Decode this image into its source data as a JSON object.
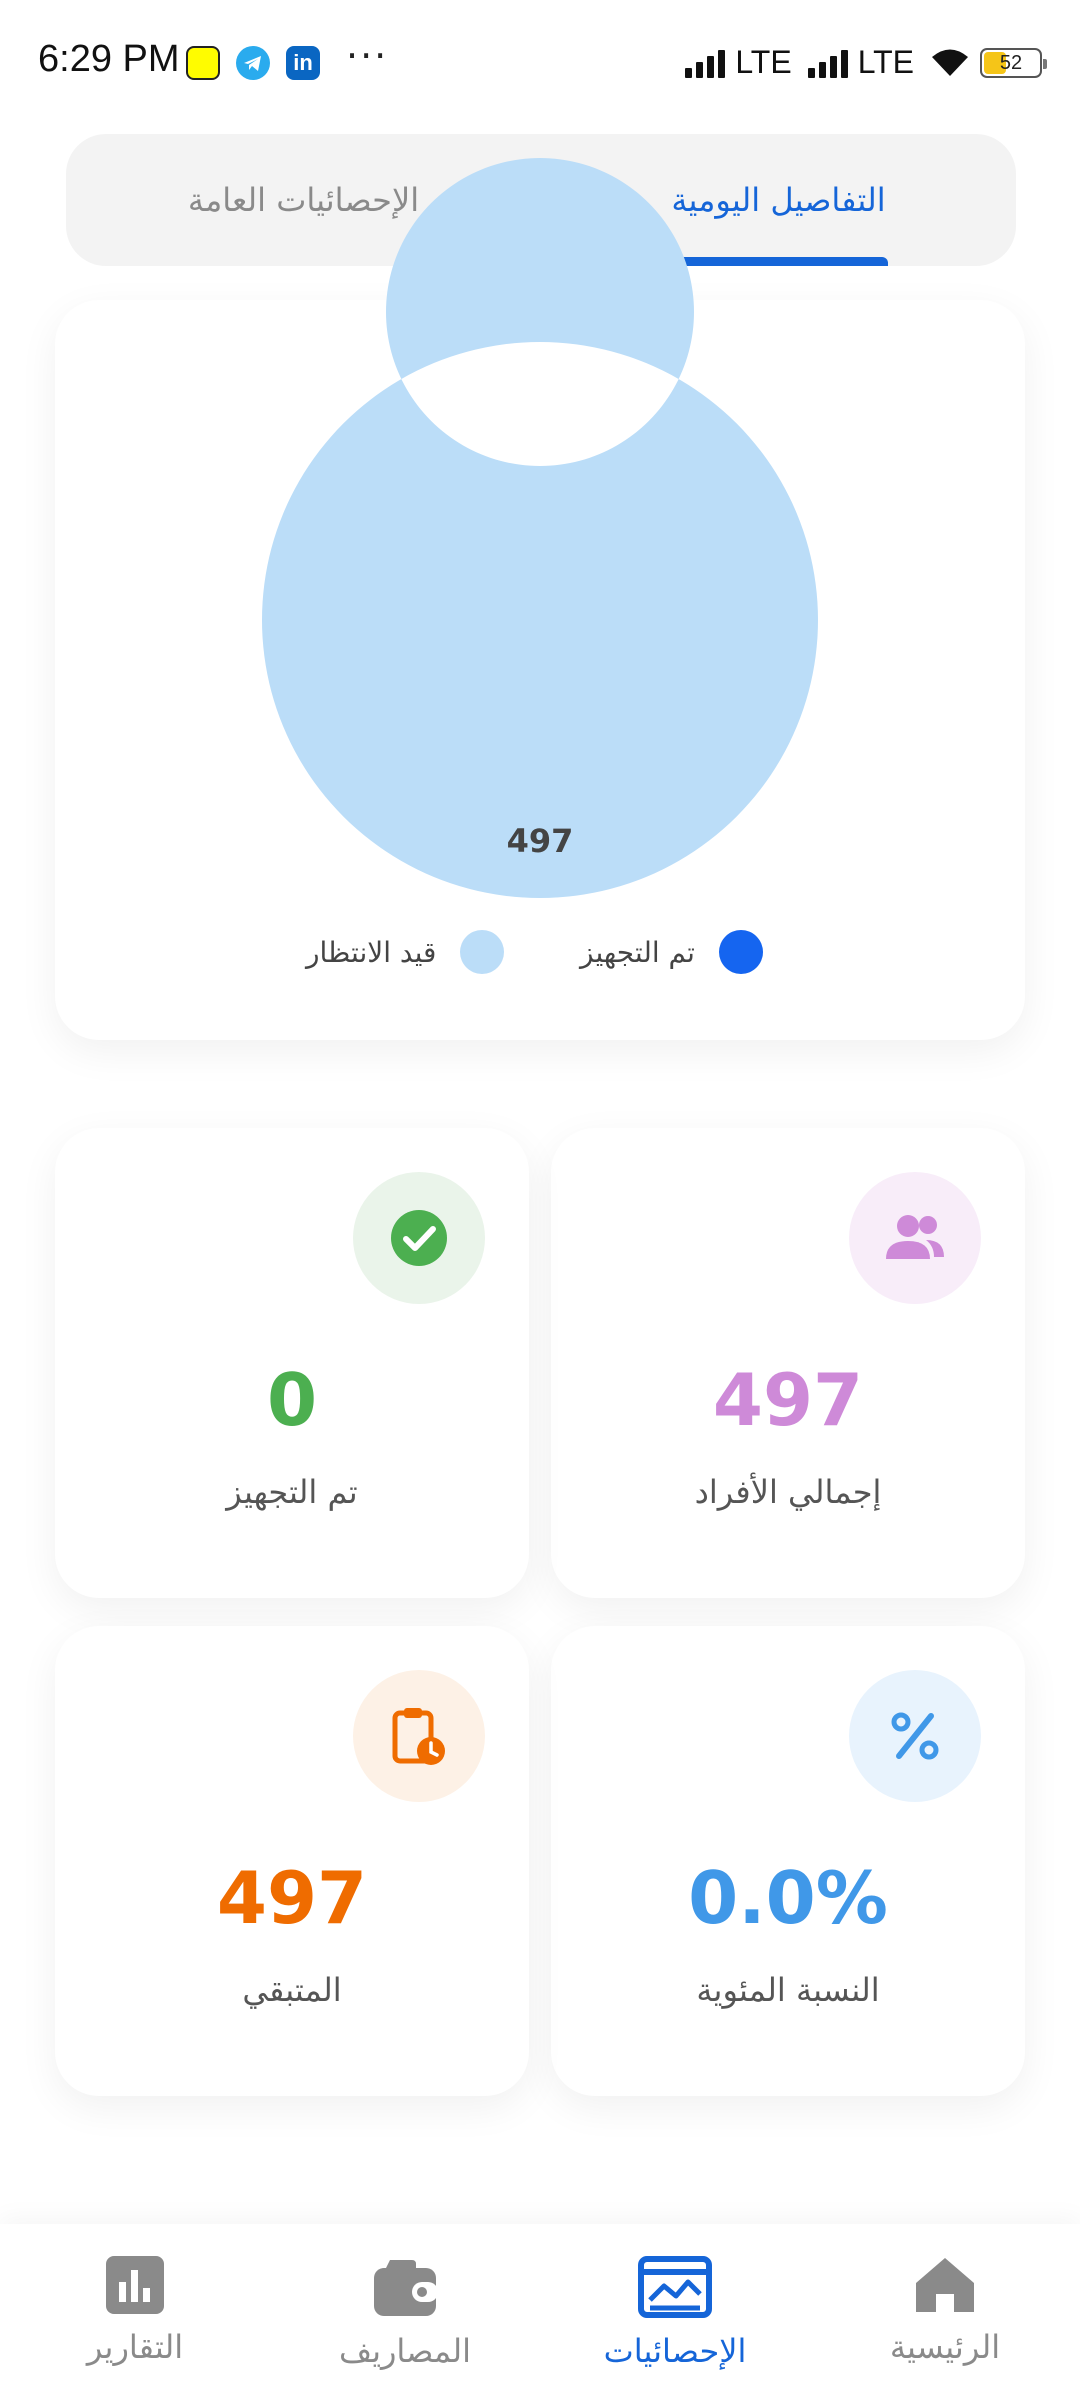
{
  "status_bar": {
    "time": "6:29 PM",
    "app_icons": [
      "snapchat-icon",
      "telegram-icon",
      "linkedin-icon"
    ],
    "linkedin_text": "in",
    "more": "···",
    "network_1": "LTE",
    "network_2": "LTE",
    "battery": "52"
  },
  "tabs": {
    "daily_details": "التفاصيل اليومية",
    "general_stats": "الإحصائيات العامة",
    "active": "daily_details"
  },
  "chart_data": {
    "type": "pie",
    "variant": "donut",
    "categories": [
      "تم التجهيز",
      "قيد الانتظار"
    ],
    "values": [
      0,
      497
    ],
    "colors": [
      "#1565F0",
      "#BBDDF8"
    ],
    "data_labels": [
      "497"
    ],
    "legend_position": "bottom"
  },
  "stats": {
    "total_members": {
      "value": "497",
      "label": "إجمالي الأفراد",
      "color": "#CE8AD8",
      "icon": "people-icon",
      "icon_bg": "#F8EDF9"
    },
    "prepared": {
      "value": "0",
      "label": "تم التجهيز",
      "color": "#4CAF50",
      "icon": "check-circle-icon",
      "icon_bg": "#EAF4EA"
    },
    "percentage": {
      "value": "0.0%",
      "label": "النسبة المئوية",
      "color": "#4098E8",
      "icon": "percent-icon",
      "icon_bg": "#E8F3FD"
    },
    "remaining": {
      "value": "497",
      "label": "المتبقي",
      "color": "#EF6C00",
      "icon": "clipboard-clock-icon",
      "icon_bg": "#FDF1E6"
    }
  },
  "bottom_nav": {
    "items": [
      {
        "label": "الرئيسية",
        "icon": "home-icon"
      },
      {
        "label": "الإحصائيات",
        "icon": "statistics-icon"
      },
      {
        "label": "المصاريف",
        "icon": "wallet-icon"
      },
      {
        "label": "التقارير",
        "icon": "bar-chart-icon"
      }
    ],
    "active_index": 1,
    "active_color": "#1565D8",
    "inactive_color": "#8A8A8A"
  }
}
